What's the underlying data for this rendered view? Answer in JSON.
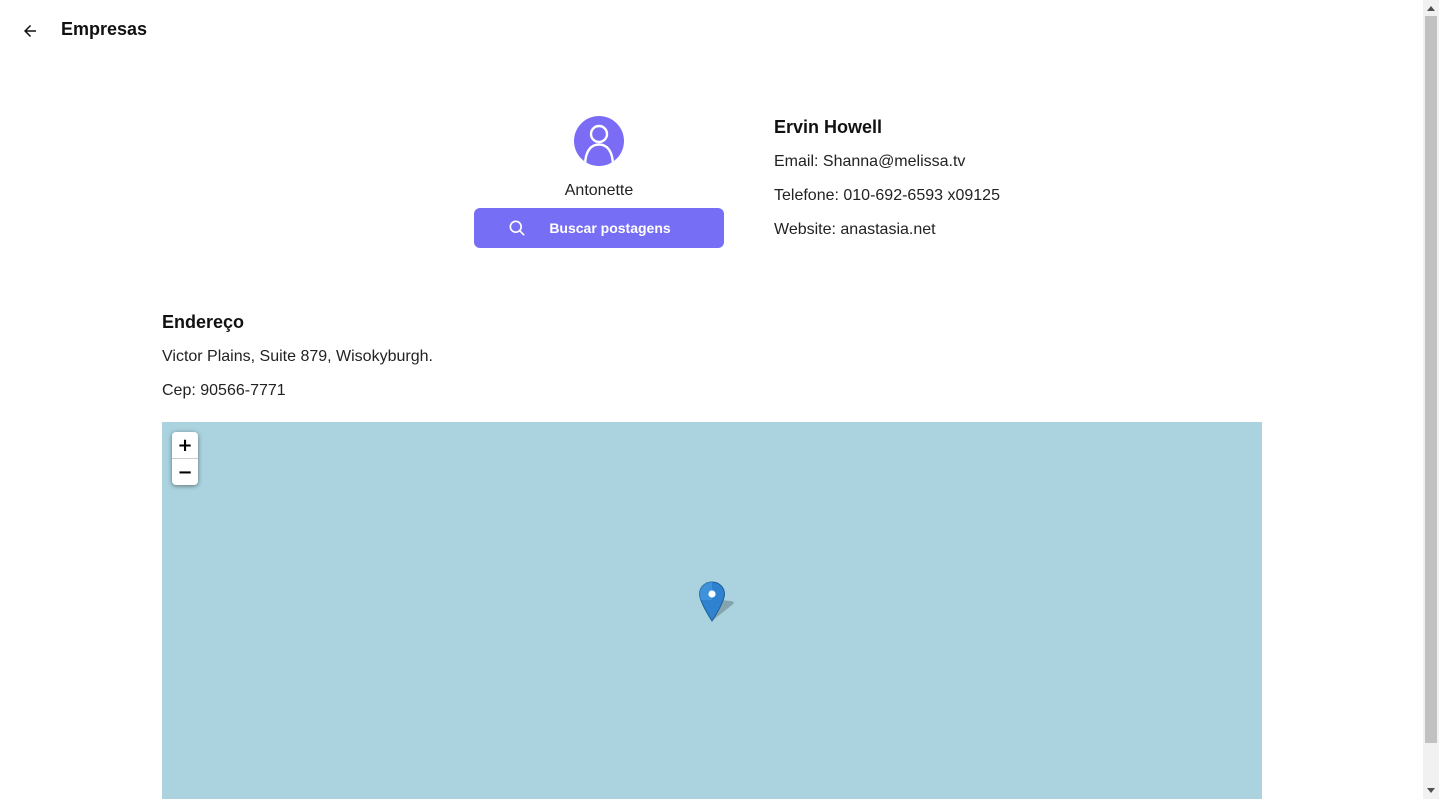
{
  "header": {
    "back_icon": "arrow-left-icon",
    "title": "Empresas"
  },
  "profile": {
    "avatar_icon": "user-icon",
    "username": "Antonette",
    "search_button": {
      "icon": "search-icon",
      "label": "Buscar postagens"
    },
    "accent_color": "#776ef6"
  },
  "details": {
    "name": "Ervin Howell",
    "email": "Email: Shanna@melissa.tv",
    "phone": "Telefone: 010-692-6593 x09125",
    "website": "Website: anastasia.net"
  },
  "address": {
    "heading": "Endereço",
    "street": "Victor Plains, Suite 879, Wisokyburgh.",
    "zip": "Cep: 90566-7771"
  },
  "map": {
    "water_color": "#aad3df",
    "zoom_in_label": "+",
    "zoom_out_label": "−",
    "marker_icon": "map-pin-icon"
  }
}
